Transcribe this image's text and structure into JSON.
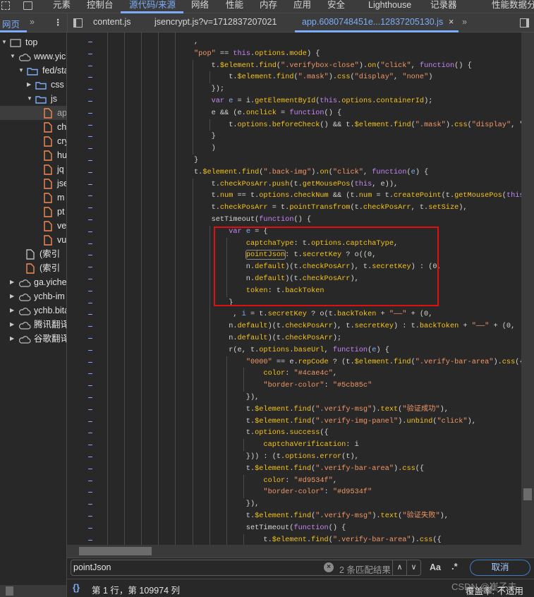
{
  "panel_tabs": [
    {
      "label": "元素"
    },
    {
      "label": "控制台"
    },
    {
      "label": "源代码/来源",
      "active": true
    },
    {
      "label": "网络"
    },
    {
      "label": "性能"
    },
    {
      "label": "内存"
    },
    {
      "label": "应用"
    },
    {
      "label": "安全"
    },
    {
      "label": "Lighthouse"
    },
    {
      "label": "记录器"
    },
    {
      "label": "性能数据分"
    }
  ],
  "navigator": {
    "tab": "网页",
    "more": "»",
    "menu": "⋮"
  },
  "file_tabs": [
    {
      "label": "content.js"
    },
    {
      "label": "jsencrypt.js?v=1712837207021"
    },
    {
      "label": "app.6080748451e...12837205130.js",
      "active": true,
      "close": "×"
    }
  ],
  "file_tabs_more": "»",
  "tree": [
    {
      "label": "top",
      "icon": "frame-icon",
      "level": 0,
      "expand": "open"
    },
    {
      "label": "www.yicl",
      "icon": "cloud-icon",
      "level": 1,
      "expand": "open"
    },
    {
      "label": "fed/sta",
      "icon": "folder-icon",
      "level": 2,
      "expand": "open"
    },
    {
      "label": "css",
      "icon": "folder-icon",
      "level": 3,
      "expand": "closed"
    },
    {
      "label": "js",
      "icon": "folder-icon",
      "level": 3,
      "expand": "open"
    },
    {
      "label": "ap",
      "icon": "js-file-icon",
      "level": 4,
      "selected": true
    },
    {
      "label": "ch",
      "icon": "js-file-icon",
      "level": 4
    },
    {
      "label": "cry",
      "icon": "js-file-icon",
      "level": 4
    },
    {
      "label": "hu",
      "icon": "js-file-icon",
      "level": 4
    },
    {
      "label": "jq",
      "icon": "js-file-icon",
      "level": 4
    },
    {
      "label": "jse",
      "icon": "js-file-icon",
      "level": 4
    },
    {
      "label": "m",
      "icon": "js-file-icon",
      "level": 4
    },
    {
      "label": "pt",
      "icon": "js-file-icon",
      "level": 4
    },
    {
      "label": "ve",
      "icon": "js-file-icon",
      "level": 4
    },
    {
      "label": "vu",
      "icon": "js-file-icon",
      "level": 4
    },
    {
      "label": "(索引",
      "icon": "file-icon",
      "level": 3
    },
    {
      "label": "(索引",
      "icon": "js-file-icon",
      "level": 3
    },
    {
      "label": "ga.yiche.",
      "icon": "cloud-icon",
      "level": 1,
      "expand": "closed"
    },
    {
      "label": "ychb-im",
      "icon": "cloud-icon",
      "level": 1,
      "expand": "closed"
    },
    {
      "label": "ychb.bita",
      "icon": "cloud-icon",
      "level": 1,
      "expand": "closed"
    },
    {
      "label": "腾讯翻译",
      "icon": "cloud-icon",
      "level": 1,
      "expand": "closed"
    },
    {
      "label": "谷歌翻译",
      "icon": "cloud-icon",
      "level": 1,
      "expand": "closed"
    }
  ],
  "code_lines": [
    ",",
    "\"pop\" == this.options.mode) {",
    "    t.$element.find(\".verifybox-close\").on(\"click\", function() {",
    "        t.$element.find(\".mask\").css(\"display\", \"none\")",
    "    });",
    "    var e = i.getElementById(this.options.containerId);",
    "    e && (e.onclick = function() {",
    "        t.options.beforeCheck() && t.$element.find(\".mask\").css(\"display\", \"bl",
    "    }",
    "    )",
    "}",
    "t.$element.find(\".back-img\").on(\"click\", function(e) {",
    "    t.checkPosArr.push(t.getMousePos(this, e)),",
    "    t.num == t.options.checkNum && (t.num = t.createPoint(t.getMousePos(this,",
    "    t.checkPosArr = t.pointTransfrom(t.checkPosArr, t.setSize),",
    "    setTimeout(function() {",
    "        var e = {",
    "            captchaType: t.options.captchaType,",
    "            pointJson: t.secretKey ? o((0,",
    "            n.default)(t.checkPosArr), t.secretKey) : (0,",
    "            n.default)(t.checkPosArr),",
    "            token: t.backToken",
    "        }",
    "         , i = t.secretKey ? o(t.backToken + \"——\" + (0,",
    "        n.default)(t.checkPosArr), t.secretKey) : t.backToken + \"——\" + (0,",
    "        n.default)(t.checkPosArr);",
    "        r(e, t.options.baseUrl, function(e) {",
    "            \"0000\" == e.repCode ? (t.$element.find(\".verify-bar-area\").css({",
    "                color: \"#4cae4c\",",
    "                \"border-color\": \"#5cb85c\"",
    "            }),",
    "            t.$element.find(\".verify-msg\").text(\"验证成功\"),",
    "            t.$element.find(\".verify-img-panel\").unbind(\"click\"),",
    "            t.options.success({",
    "                captchaVerification: i",
    "            })) : (t.options.error(t),",
    "            t.$element.find(\".verify-bar-area\").css({",
    "                color: \"#d9534f\",",
    "                \"border-color\": \"#d9534f\"",
    "            }),",
    "            t.$element.find(\".verify-msg\").text(\"验证失败\"),",
    "            setTimeout(function() {",
    "                t.$element.find(\".verify-bar-area\").css({"
  ],
  "search": {
    "query": "pointJson",
    "clear": "×",
    "count": "2 条匹配结果",
    "prev": "∧",
    "next": "∨",
    "match_case": "Aa",
    "regex": ".*",
    "cancel": "取消"
  },
  "status": {
    "braces": "{}",
    "position": "第 1 行，第 109974 列",
    "coverage": "覆盖率: 不适用"
  },
  "watermark": "CSDN @崔子未",
  "colors": {
    "accent": "#7cacf8",
    "highlight_box": "#e01010",
    "string": "#f29766",
    "keyword": "#c586f7",
    "property": "#f5c21b"
  }
}
